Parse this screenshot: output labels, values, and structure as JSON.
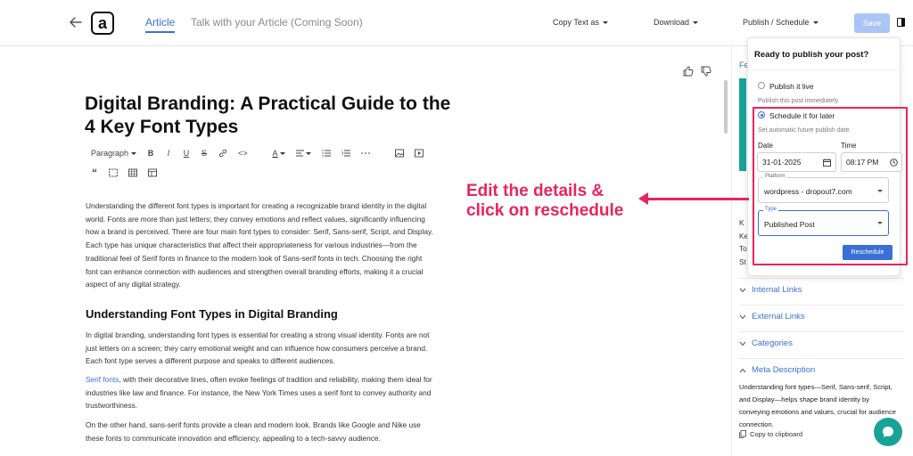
{
  "header": {
    "logo_letter": "a",
    "tabs": [
      {
        "label": "Article"
      },
      {
        "label": "Talk with your Article (Coming Soon)"
      }
    ],
    "menus": {
      "copy_text": "Copy Text as",
      "download": "Download",
      "publish": "Publish / Schedule"
    },
    "save_label": "Save"
  },
  "editor": {
    "title": "Digital Branding: A Practical Guide to the 4 Key Font Types",
    "toolbar": {
      "block_type": "Paragraph",
      "bold": "B",
      "italic": "I",
      "underline": "U",
      "strike": "S",
      "code": "<>",
      "text_color": "A",
      "quote": "“"
    },
    "paragraph1": "Understanding the different font types is important for creating a recognizable brand identity in the digital world. Fonts are more than just letters; they convey emotions and reflect values, significantly influencing how a brand is perceived. There are four main font types to consider: Serif, Sans-serif, Script, and Display. Each type has unique characteristics that affect their appropriateness for various industries—from the traditional feel of Serif fonts in finance to the modern look of Sans-serif fonts in tech. Choosing the right font can enhance connection with audiences and strengthen overall branding efforts, making it a crucial aspect of any digital strategy.",
    "heading2": "Understanding Font Types in Digital Branding",
    "paragraph2": "In digital branding, understanding font types is essential for creating a strong visual identity. Fonts are not just letters on a screen; they carry emotional weight and can influence how consumers perceive a brand. Each font type serves a different purpose and speaks to different audiences.",
    "paragraph3_link": "Serif fonts",
    "paragraph3_rest": ", with their decorative lines, often evoke feelings of tradition and reliability, making them ideal for industries like law and finance. For instance, the New York Times uses a serif font to convey authority and trustworthiness.",
    "paragraph4": "On the other hand, sans-serif fonts provide a clean and modern look. Brands like Google and Nike use these fonts to communicate innovation and efficiency, appealing to a tech-savvy audience."
  },
  "popover": {
    "title": "Ready to publish your post?",
    "option_live": {
      "label": "Publish it live",
      "sub": "Publish this post immediately",
      "selected": false
    },
    "option_later": {
      "label": "Schedule it for later",
      "sub": "Set automatic future publish date",
      "selected": true
    },
    "date_label": "Date",
    "date_value": "31-01-2025",
    "time_label": "Time",
    "time_value": "08:17 PM",
    "platform_label": "Platform",
    "platform_value": "wordpress - dropout7.com",
    "type_label": "Type",
    "type_value": "Published Post",
    "reschedule_label": "Reschedule"
  },
  "sidebar": {
    "fe_fragment": "Fe",
    "letters": [
      "K",
      "Ke",
      "To",
      "St"
    ],
    "sections": [
      {
        "label": "Internal Links",
        "expanded": false
      },
      {
        "label": "External Links",
        "expanded": false
      },
      {
        "label": "Categories",
        "expanded": false
      },
      {
        "label": "Meta Description",
        "expanded": true
      }
    ],
    "meta_description": "Understanding font types—Serif, Sans-serif, Script, and Display—helps shape brand identity by conveying emotions and values, crucial for audience connection.",
    "copy_label": "Copy to clipboard"
  },
  "annotation": {
    "line1": "Edit the details &",
    "line2": "click on reschedule"
  },
  "colors": {
    "accent": "#3b6fd8",
    "annotation": "#e8255c",
    "teal": "#17a398"
  }
}
